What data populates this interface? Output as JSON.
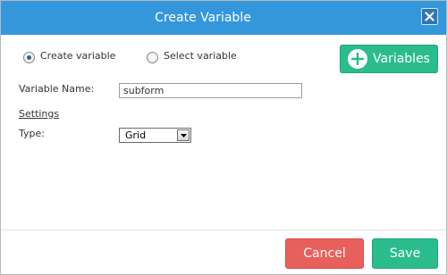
{
  "dialog": {
    "title": "Create Variable",
    "close_icon": "close-icon"
  },
  "mode": {
    "options": [
      {
        "label": "Create variable",
        "selected": true
      },
      {
        "label": "Select variable",
        "selected": false
      }
    ]
  },
  "variables_button": {
    "label": "Variables",
    "icon": "plus-circle-icon"
  },
  "form": {
    "variable_name_label": "Variable Name:",
    "variable_name_value": "subform",
    "settings_label": "Settings",
    "type_label": "Type:",
    "type_value": "Grid"
  },
  "footer": {
    "cancel_label": "Cancel",
    "save_label": "Save"
  },
  "colors": {
    "titlebar": "#3497db",
    "accent_green": "#2abc8c",
    "cancel_red": "#e8605b"
  }
}
